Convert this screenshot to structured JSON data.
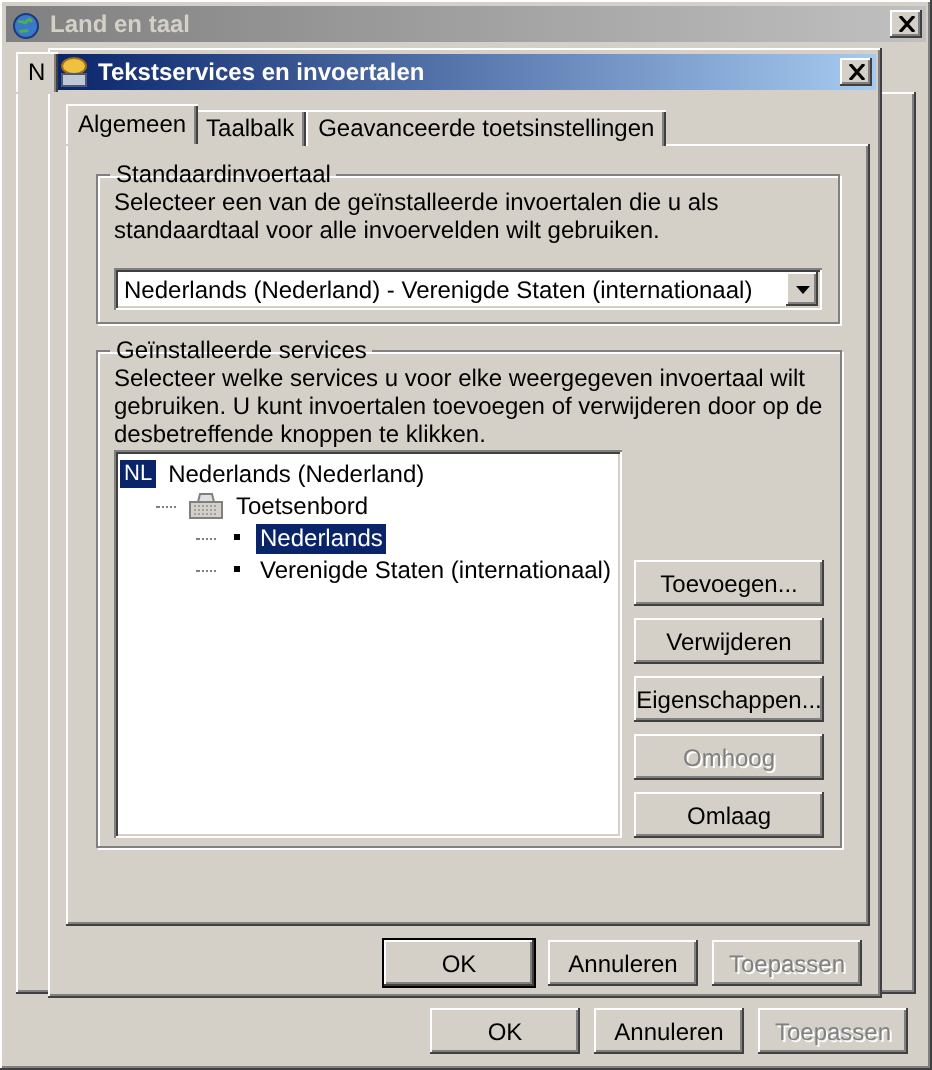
{
  "outer_window": {
    "title": "Land en taal",
    "active": false,
    "tabs": [
      {
        "label": "N",
        "selected": true
      }
    ],
    "buttons": [
      {
        "label": "OK",
        "default": false,
        "disabled": false
      },
      {
        "label": "Annuleren",
        "default": false,
        "disabled": false
      },
      {
        "label": "Toepassen",
        "default": false,
        "disabled": true
      }
    ]
  },
  "dialog": {
    "title": "Tekstservices en invoertalen",
    "active": true,
    "tabs": [
      {
        "label": "Algemeen",
        "selected": true
      },
      {
        "label": "Taalbalk",
        "selected": false
      },
      {
        "label": "Geavanceerde toetsinstellingen",
        "selected": false
      }
    ],
    "default_language": {
      "legend": "Standaardinvoertaal",
      "description": "Selecteer een van de geïnstalleerde invoertalen die u als standaardtaal voor alle invoervelden wilt gebruiken.",
      "dropdown_value": "Nederlands (Nederland) - Verenigde Staten (internationaal)"
    },
    "services": {
      "legend": "Geïnstalleerde services",
      "description": "Selecteer welke services u voor elke weergegeven invoertaal wilt gebruiken. U kunt invoertalen toevoegen of verwijderen door op de desbetreffende knoppen te klikken.",
      "tree": [
        {
          "kind": "language",
          "badge": "NL",
          "label": "Nederlands (Nederland)",
          "selected": false,
          "children": [
            {
              "kind": "category",
              "label": "Toetsenbord",
              "selected": false,
              "children": [
                {
                  "kind": "service",
                  "label": "Nederlands",
                  "selected": true
                },
                {
                  "kind": "service",
                  "label": "Verenigde Staten (internationaal)",
                  "selected": false
                }
              ]
            }
          ]
        }
      ],
      "buttons": [
        {
          "label": "Toevoegen...",
          "disabled": false
        },
        {
          "label": "Verwijderen",
          "disabled": false
        },
        {
          "label": "Eigenschappen...",
          "disabled": false
        },
        {
          "label": "Omhoog",
          "disabled": true
        },
        {
          "label": "Omlaag",
          "disabled": false
        }
      ]
    },
    "buttons": [
      {
        "label": "OK",
        "default": true,
        "disabled": false
      },
      {
        "label": "Annuleren",
        "default": false,
        "disabled": false
      },
      {
        "label": "Toepassen",
        "default": false,
        "disabled": true
      }
    ]
  }
}
